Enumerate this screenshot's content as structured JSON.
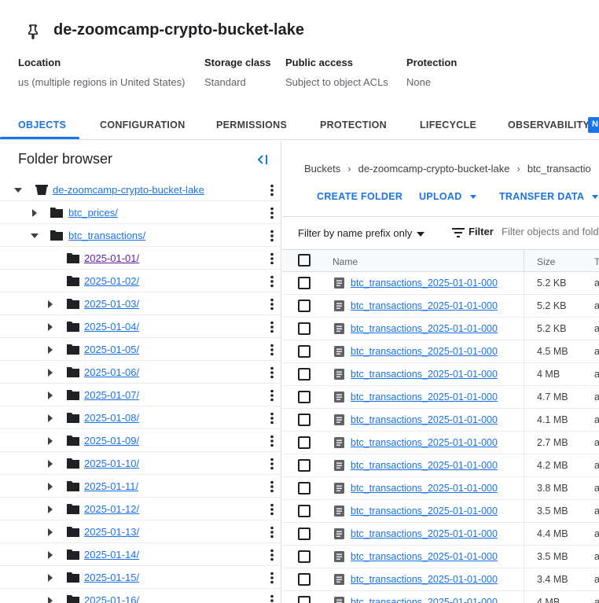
{
  "bucket": {
    "title": "de-zoomcamp-crypto-bucket-lake",
    "pin_icon": "keep-pin-icon"
  },
  "meta": [
    {
      "key": "Location",
      "value": "us (multiple regions in United States)"
    },
    {
      "key": "Storage class",
      "value": "Standard"
    },
    {
      "key": "Public access",
      "value": "Subject to object ACLs"
    },
    {
      "key": "Protection",
      "value": "None"
    }
  ],
  "tabs": [
    {
      "label": "OBJECTS",
      "active": true
    },
    {
      "label": "CONFIGURATION",
      "active": false
    },
    {
      "label": "PERMISSIONS",
      "active": false
    },
    {
      "label": "PROTECTION",
      "active": false
    },
    {
      "label": "LIFECYCLE",
      "active": false
    },
    {
      "label": "OBSERVABILITY",
      "active": false
    }
  ],
  "new_badge": "N",
  "folder_browser": {
    "title": "Folder browser",
    "items": [
      {
        "label": "de-zoomcamp-crypto-bucket-lake",
        "level": 0,
        "caret": "down",
        "icon": "bucket-icon"
      },
      {
        "label": "btc_prices/",
        "level": 1,
        "caret": "right",
        "icon": "folder-icon"
      },
      {
        "label": "btc_transactions/",
        "level": 1,
        "caret": "down",
        "icon": "folder-icon"
      },
      {
        "label": "2025-01-01/",
        "level": 2,
        "caret": "none",
        "icon": "folder-icon",
        "visited": true
      },
      {
        "label": "2025-01-02/",
        "level": 2,
        "caret": "none",
        "icon": "folder-icon"
      },
      {
        "label": "2025-01-03/",
        "level": 2,
        "caret": "right",
        "icon": "folder-icon"
      },
      {
        "label": "2025-01-04/",
        "level": 2,
        "caret": "right",
        "icon": "folder-icon"
      },
      {
        "label": "2025-01-05/",
        "level": 2,
        "caret": "right",
        "icon": "folder-icon"
      },
      {
        "label": "2025-01-06/",
        "level": 2,
        "caret": "right",
        "icon": "folder-icon"
      },
      {
        "label": "2025-01-07/",
        "level": 2,
        "caret": "right",
        "icon": "folder-icon"
      },
      {
        "label": "2025-01-08/",
        "level": 2,
        "caret": "right",
        "icon": "folder-icon"
      },
      {
        "label": "2025-01-09/",
        "level": 2,
        "caret": "right",
        "icon": "folder-icon"
      },
      {
        "label": "2025-01-10/",
        "level": 2,
        "caret": "right",
        "icon": "folder-icon"
      },
      {
        "label": "2025-01-11/",
        "level": 2,
        "caret": "right",
        "icon": "folder-icon"
      },
      {
        "label": "2025-01-12/",
        "level": 2,
        "caret": "right",
        "icon": "folder-icon"
      },
      {
        "label": "2025-01-13/",
        "level": 2,
        "caret": "right",
        "icon": "folder-icon"
      },
      {
        "label": "2025-01-14/",
        "level": 2,
        "caret": "right",
        "icon": "folder-icon"
      },
      {
        "label": "2025-01-15/",
        "level": 2,
        "caret": "right",
        "icon": "folder-icon"
      },
      {
        "label": "2025-01-16/",
        "level": 2,
        "caret": "right",
        "icon": "folder-icon"
      }
    ]
  },
  "breadcrumbs": [
    "Buckets",
    "de-zoomcamp-crypto-bucket-lake",
    "btc_transactio"
  ],
  "actions": {
    "create_folder": "CREATE FOLDER",
    "upload": "UPLOAD",
    "transfer_data": "TRANSFER DATA"
  },
  "filter": {
    "prefix_label": "Filter by name prefix only",
    "filter_label": "Filter",
    "placeholder": "Filter objects and folders"
  },
  "table": {
    "columns": {
      "name": "Name",
      "size": "Size",
      "type": "T"
    },
    "rows": [
      {
        "name": "btc_transactions_2025-01-01-000",
        "size": "5.2 KB",
        "type": "a"
      },
      {
        "name": "btc_transactions_2025-01-01-000",
        "size": "5.2 KB",
        "type": "a"
      },
      {
        "name": "btc_transactions_2025-01-01-000",
        "size": "5.2 KB",
        "type": "a"
      },
      {
        "name": "btc_transactions_2025-01-01-000",
        "size": "4.5 MB",
        "type": "a"
      },
      {
        "name": "btc_transactions_2025-01-01-000",
        "size": "4 MB",
        "type": "a"
      },
      {
        "name": "btc_transactions_2025-01-01-000",
        "size": "4.7 MB",
        "type": "a"
      },
      {
        "name": "btc_transactions_2025-01-01-000",
        "size": "4.1 MB",
        "type": "a"
      },
      {
        "name": "btc_transactions_2025-01-01-000",
        "size": "2.7 MB",
        "type": "a"
      },
      {
        "name": "btc_transactions_2025-01-01-000",
        "size": "4.2 MB",
        "type": "a"
      },
      {
        "name": "btc_transactions_2025-01-01-000",
        "size": "3.8 MB",
        "type": "a"
      },
      {
        "name": "btc_transactions_2025-01-01-000",
        "size": "3.5 MB",
        "type": "a"
      },
      {
        "name": "btc_transactions_2025-01-01-000",
        "size": "4.4 MB",
        "type": "a"
      },
      {
        "name": "btc_transactions_2025-01-01-000",
        "size": "3.5 MB",
        "type": "a"
      },
      {
        "name": "btc_transactions_2025-01-01-000",
        "size": "3.4 MB",
        "type": "a"
      },
      {
        "name": "btc_transactions_2025-01-01-000",
        "size": "4 MB",
        "type": "a"
      }
    ]
  },
  "colors": {
    "accent": "#1a73e8",
    "visited_link": "#681da8",
    "text": "#202124",
    "muted": "#5f6368",
    "border": "#dadce0"
  }
}
